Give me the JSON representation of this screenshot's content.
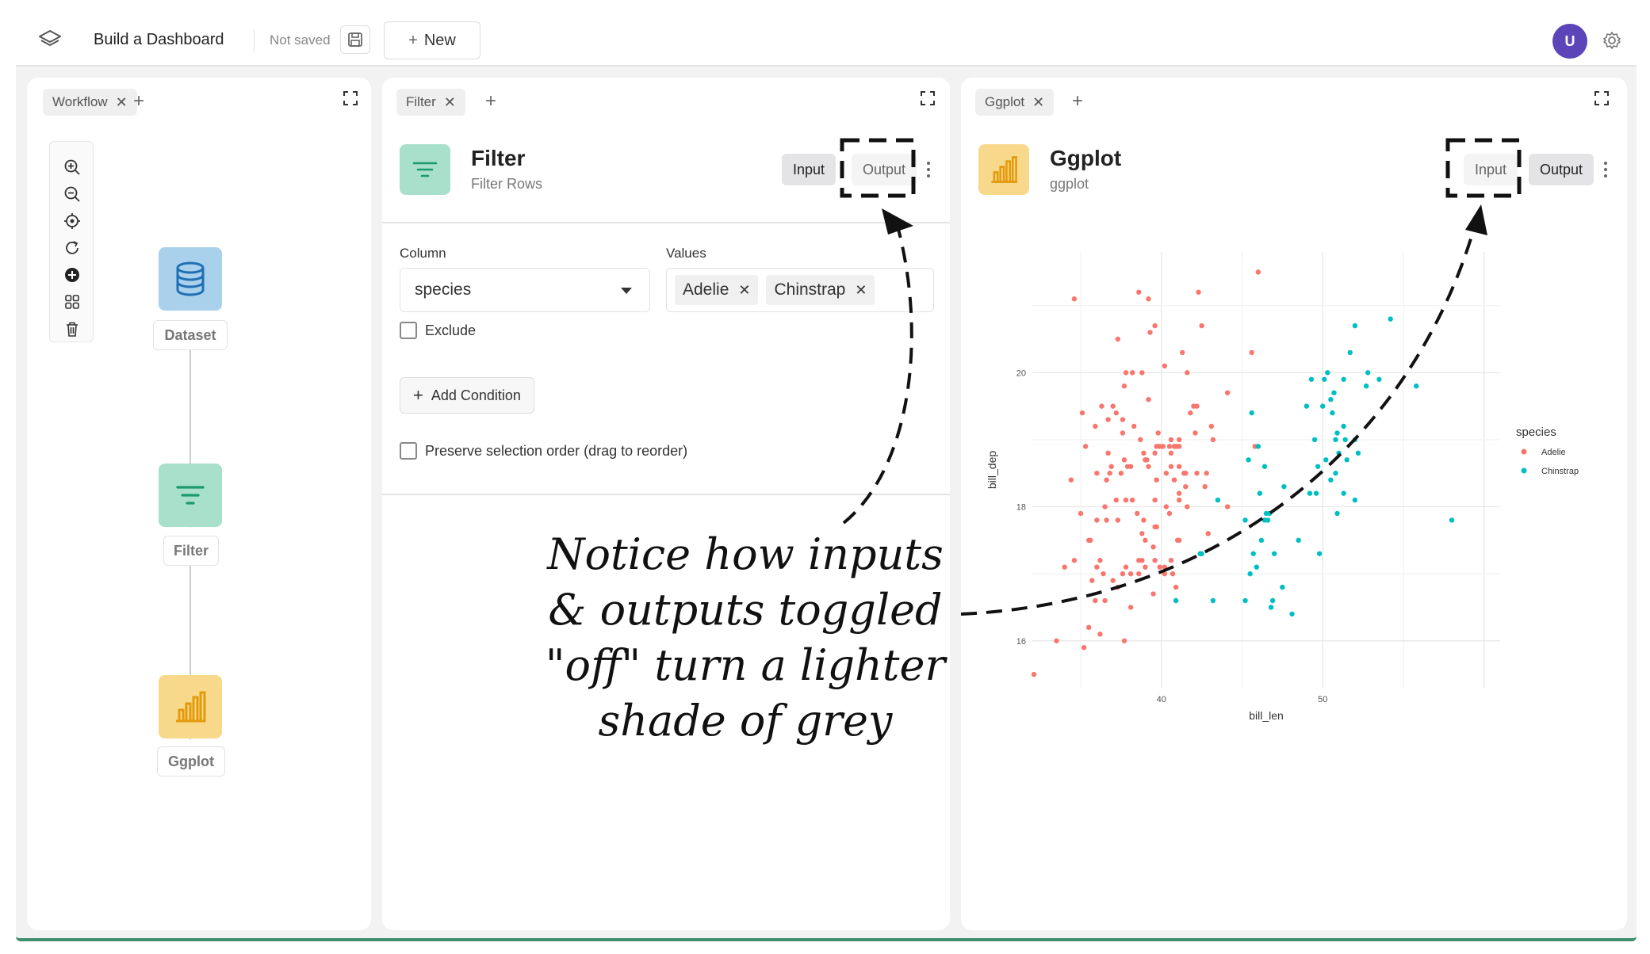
{
  "topbar": {
    "title": "Build a Dashboard",
    "save_status": "Not saved",
    "new_label": "New",
    "avatar_initial": "U"
  },
  "workflow_panel": {
    "tab_label": "Workflow",
    "tools": [
      "zoom-in-icon",
      "zoom-out-icon",
      "target-icon",
      "refresh-icon",
      "add-node-icon",
      "grid-icon",
      "trash-icon"
    ],
    "nodes": [
      {
        "label": "Dataset",
        "icon": "database-icon",
        "color": "#a9d1ec"
      },
      {
        "label": "Filter",
        "icon": "filter-icon",
        "color": "#a8e0cb"
      },
      {
        "label": "Ggplot",
        "icon": "bar-chart-icon",
        "color": "#f8d98c"
      }
    ]
  },
  "filter_panel": {
    "tab_label": "Filter",
    "title": "Filter",
    "subtitle": "Filter Rows",
    "input_label": "Input",
    "output_label": "Output",
    "column_label": "Column",
    "column_value": "species",
    "values_label": "Values",
    "values": [
      "Adelie",
      "Chinstrap"
    ],
    "exclude_label": "Exclude",
    "add_condition_label": "Add Condition",
    "preserve_label": "Preserve selection order (drag to reorder)"
  },
  "ggplot_panel": {
    "tab_label": "Ggplot",
    "title": "Ggplot",
    "subtitle": "ggplot",
    "input_label": "Input",
    "output_label": "Output"
  },
  "annotation": {
    "lines": [
      "Notice how inputs",
      "& outputs toggled",
      "\"off\" turn a lighter",
      "shade of grey"
    ]
  },
  "colors": {
    "accent": "#5b45b8",
    "adelie": "#f8766d",
    "chinstrap": "#00bfc4"
  },
  "chart_data": {
    "type": "scatter",
    "xlabel": "bill_len",
    "ylabel": "bill_dep",
    "xlim": [
      32,
      61
    ],
    "ylim": [
      15.3,
      21.8
    ],
    "x_ticks": [
      40,
      50
    ],
    "y_ticks": [
      16,
      18,
      20
    ],
    "grid": true,
    "legend_title": "species",
    "legend_position": "right",
    "series": [
      {
        "name": "Adelie",
        "color": "#f8766d",
        "points": [
          [
            32.1,
            15.5
          ],
          [
            33.5,
            16.0
          ],
          [
            34.0,
            17.1
          ],
          [
            34.4,
            18.4
          ],
          [
            34.6,
            17.2
          ],
          [
            34.6,
            21.1
          ],
          [
            35.0,
            17.9
          ],
          [
            35.1,
            19.4
          ],
          [
            35.2,
            15.9
          ],
          [
            35.3,
            18.9
          ],
          [
            35.5,
            16.2
          ],
          [
            35.5,
            17.5
          ],
          [
            35.6,
            17.5
          ],
          [
            35.7,
            16.9
          ],
          [
            35.9,
            16.6
          ],
          [
            35.9,
            19.2
          ],
          [
            36.0,
            17.1
          ],
          [
            36.0,
            17.8
          ],
          [
            36.0,
            18.5
          ],
          [
            36.2,
            16.1
          ],
          [
            36.2,
            17.2
          ],
          [
            36.3,
            19.5
          ],
          [
            36.4,
            17.0
          ],
          [
            36.5,
            16.6
          ],
          [
            36.5,
            18.0
          ],
          [
            36.6,
            17.8
          ],
          [
            36.6,
            18.4
          ],
          [
            36.7,
            18.8
          ],
          [
            36.7,
            19.3
          ],
          [
            36.8,
            18.5
          ],
          [
            36.9,
            18.6
          ],
          [
            37.0,
            16.9
          ],
          [
            37.0,
            19.5
          ],
          [
            37.2,
            18.1
          ],
          [
            37.2,
            19.4
          ],
          [
            37.3,
            16.8
          ],
          [
            37.3,
            17.8
          ],
          [
            37.3,
            20.5
          ],
          [
            37.5,
            18.5
          ],
          [
            37.6,
            17.0
          ],
          [
            37.6,
            19.1
          ],
          [
            37.6,
            19.3
          ],
          [
            37.7,
            16.0
          ],
          [
            37.7,
            18.7
          ],
          [
            37.7,
            19.8
          ],
          [
            37.8,
            17.1
          ],
          [
            37.8,
            18.1
          ],
          [
            37.8,
            20.0
          ],
          [
            37.9,
            18.6
          ],
          [
            38.1,
            16.5
          ],
          [
            38.1,
            17.0
          ],
          [
            38.1,
            18.6
          ],
          [
            38.2,
            18.1
          ],
          [
            38.2,
            20.0
          ],
          [
            38.3,
            19.2
          ],
          [
            38.5,
            17.9
          ],
          [
            38.6,
            17.0
          ],
          [
            38.6,
            17.2
          ],
          [
            38.6,
            21.2
          ],
          [
            38.7,
            19.0
          ],
          [
            38.8,
            17.2
          ],
          [
            38.8,
            17.6
          ],
          [
            38.8,
            20.0
          ],
          [
            38.9,
            17.8
          ],
          [
            38.9,
            18.8
          ],
          [
            39.0,
            17.1
          ],
          [
            39.0,
            17.5
          ],
          [
            39.0,
            18.7
          ],
          [
            39.1,
            18.7
          ],
          [
            39.2,
            18.6
          ],
          [
            39.2,
            19.6
          ],
          [
            39.2,
            21.1
          ],
          [
            39.3,
            20.6
          ],
          [
            39.5,
            16.7
          ],
          [
            39.5,
            17.4
          ],
          [
            39.6,
            17.2
          ],
          [
            39.6,
            17.7
          ],
          [
            39.6,
            18.1
          ],
          [
            39.6,
            18.8
          ],
          [
            39.6,
            20.7
          ],
          [
            39.7,
            17.7
          ],
          [
            39.7,
            18.4
          ],
          [
            39.7,
            18.9
          ],
          [
            39.8,
            19.1
          ],
          [
            39.9,
            17.1
          ],
          [
            39.9,
            18.9
          ],
          [
            40.1,
            18.9
          ],
          [
            40.2,
            17.0
          ],
          [
            40.2,
            17.1
          ],
          [
            40.2,
            20.1
          ],
          [
            40.3,
            18.0
          ],
          [
            40.3,
            18.5
          ],
          [
            40.5,
            17.9
          ],
          [
            40.5,
            18.9
          ],
          [
            40.6,
            17.2
          ],
          [
            40.6,
            18.6
          ],
          [
            40.6,
            18.8
          ],
          [
            40.6,
            19.0
          ],
          [
            40.7,
            17.0
          ],
          [
            40.8,
            18.4
          ],
          [
            40.8,
            18.9
          ],
          [
            40.9,
            16.6
          ],
          [
            40.9,
            16.8
          ],
          [
            40.9,
            18.9
          ],
          [
            41.0,
            17.5
          ],
          [
            41.1,
            17.5
          ],
          [
            41.1,
            18.1
          ],
          [
            41.1,
            18.2
          ],
          [
            41.1,
            18.6
          ],
          [
            41.1,
            18.9
          ],
          [
            41.1,
            19.0
          ],
          [
            41.3,
            20.3
          ],
          [
            41.4,
            18.5
          ],
          [
            41.5,
            18.3
          ],
          [
            41.5,
            18.5
          ],
          [
            41.6,
            18.0
          ],
          [
            41.6,
            20.0
          ],
          [
            41.8,
            19.4
          ],
          [
            42.0,
            19.5
          ],
          [
            42.1,
            19.1
          ],
          [
            42.2,
            18.5
          ],
          [
            42.2,
            19.5
          ],
          [
            42.3,
            21.2
          ],
          [
            42.5,
            20.7
          ],
          [
            42.7,
            18.3
          ],
          [
            42.8,
            18.5
          ],
          [
            42.9,
            17.6
          ],
          [
            43.1,
            19.2
          ],
          [
            43.2,
            19.0
          ],
          [
            44.1,
            18.0
          ],
          [
            44.1,
            19.7
          ],
          [
            45.6,
            20.3
          ],
          [
            45.8,
            18.9
          ],
          [
            46.0,
            21.5
          ]
        ]
      },
      {
        "name": "Chinstrap",
        "color": "#00bfc4",
        "points": [
          [
            40.9,
            16.6
          ],
          [
            42.4,
            17.3
          ],
          [
            42.5,
            17.3
          ],
          [
            43.2,
            16.6
          ],
          [
            43.5,
            18.1
          ],
          [
            45.2,
            16.6
          ],
          [
            45.2,
            17.8
          ],
          [
            45.4,
            18.7
          ],
          [
            45.5,
            17.0
          ],
          [
            45.6,
            19.4
          ],
          [
            45.7,
            17.3
          ],
          [
            45.9,
            17.1
          ],
          [
            46.0,
            18.9
          ],
          [
            46.1,
            18.2
          ],
          [
            46.2,
            17.5
          ],
          [
            46.4,
            17.8
          ],
          [
            46.4,
            18.6
          ],
          [
            46.5,
            17.9
          ],
          [
            46.6,
            17.8
          ],
          [
            46.7,
            17.9
          ],
          [
            46.8,
            16.5
          ],
          [
            46.9,
            16.6
          ],
          [
            47.0,
            17.3
          ],
          [
            47.5,
            16.8
          ],
          [
            47.6,
            18.3
          ],
          [
            48.1,
            16.4
          ],
          [
            48.5,
            17.5
          ],
          [
            49.0,
            19.5
          ],
          [
            49.2,
            18.2
          ],
          [
            49.3,
            19.9
          ],
          [
            49.5,
            19.0
          ],
          [
            49.6,
            18.2
          ],
          [
            49.7,
            18.6
          ],
          [
            49.8,
            17.3
          ],
          [
            50.0,
            19.5
          ],
          [
            50.1,
            19.9
          ],
          [
            50.2,
            18.7
          ],
          [
            50.3,
            20.0
          ],
          [
            50.5,
            18.4
          ],
          [
            50.5,
            19.6
          ],
          [
            50.6,
            19.4
          ],
          [
            50.7,
            19.7
          ],
          [
            50.8,
            18.5
          ],
          [
            50.8,
            19.0
          ],
          [
            50.9,
            17.9
          ],
          [
            50.9,
            19.1
          ],
          [
            51.0,
            18.8
          ],
          [
            51.3,
            18.2
          ],
          [
            51.3,
            19.2
          ],
          [
            51.3,
            19.9
          ],
          [
            51.4,
            19.0
          ],
          [
            51.5,
            18.7
          ],
          [
            51.7,
            20.3
          ],
          [
            52.0,
            18.1
          ],
          [
            52.0,
            19.0
          ],
          [
            52.0,
            20.7
          ],
          [
            52.2,
            18.8
          ],
          [
            52.7,
            19.8
          ],
          [
            52.8,
            20.0
          ],
          [
            53.5,
            19.9
          ],
          [
            54.2,
            20.8
          ],
          [
            55.8,
            19.8
          ],
          [
            58.0,
            17.8
          ]
        ]
      }
    ]
  }
}
